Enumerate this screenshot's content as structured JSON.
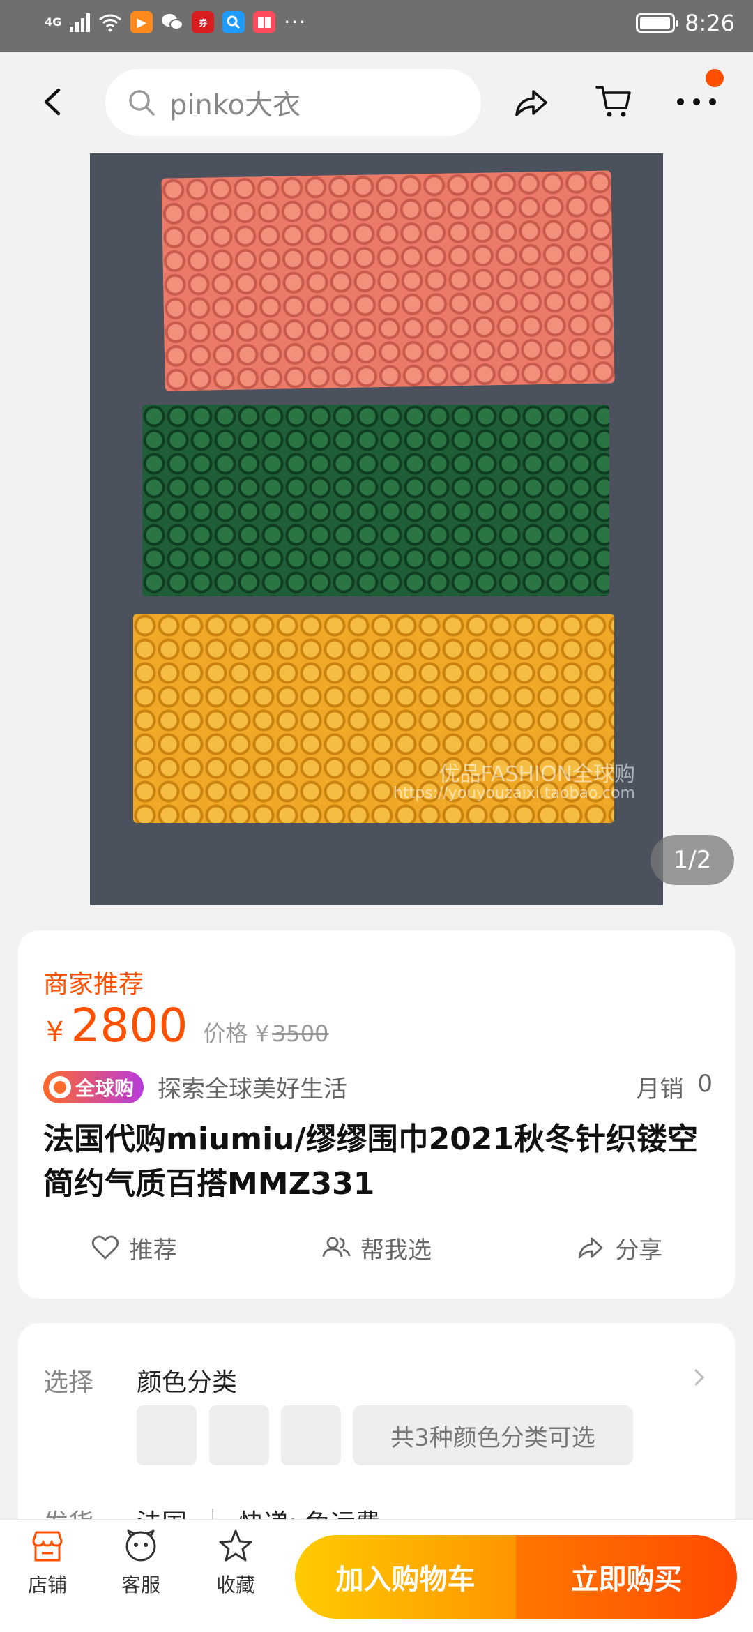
{
  "status_bar": {
    "network": "4G",
    "time": "8:26",
    "more": "···",
    "icons": [
      "signal-icon",
      "wifi-icon",
      "video-app-icon",
      "wechat-icon",
      "red-app-icon",
      "search-app-icon",
      "book-app-icon"
    ]
  },
  "header": {
    "search_placeholder": "pinko大衣",
    "icons": [
      "back-arrow-icon",
      "search-icon",
      "share-icon",
      "cart-icon",
      "more-dots-icon"
    ],
    "accent_color": "#ff5000"
  },
  "gallery": {
    "counter": "1/2",
    "watermark_line1": "优品FASHION全球购",
    "watermark_line2": "https://youyouzaixi.taobao.com"
  },
  "product": {
    "recommend_label": "商家推荐",
    "currency": "¥",
    "price": "2800",
    "original_price_label": "价格 ¥",
    "original_price": "3500",
    "global_badge": "全球购",
    "slogan": "探索全球美好生活",
    "monthly_sales_label": "月销",
    "monthly_sales": "0",
    "title": "法国代购miumiu/缪缪围巾2021秋冬针织镂空简约气质百搭MMZ331",
    "actions": {
      "recommend": "推荐",
      "help_choose": "帮我选",
      "share": "分享"
    }
  },
  "options": {
    "select_label": "选择",
    "select_value": "颜色分类",
    "more_text": "共3种颜色分类可选",
    "ship_label": "发货",
    "ship_origin": "法国",
    "ship_fee": "快递: 免运费"
  },
  "bottom_bar": {
    "store": "店铺",
    "service": "客服",
    "favorite": "收藏",
    "add_to_cart": "加入购物车",
    "buy_now": "立即购买"
  }
}
